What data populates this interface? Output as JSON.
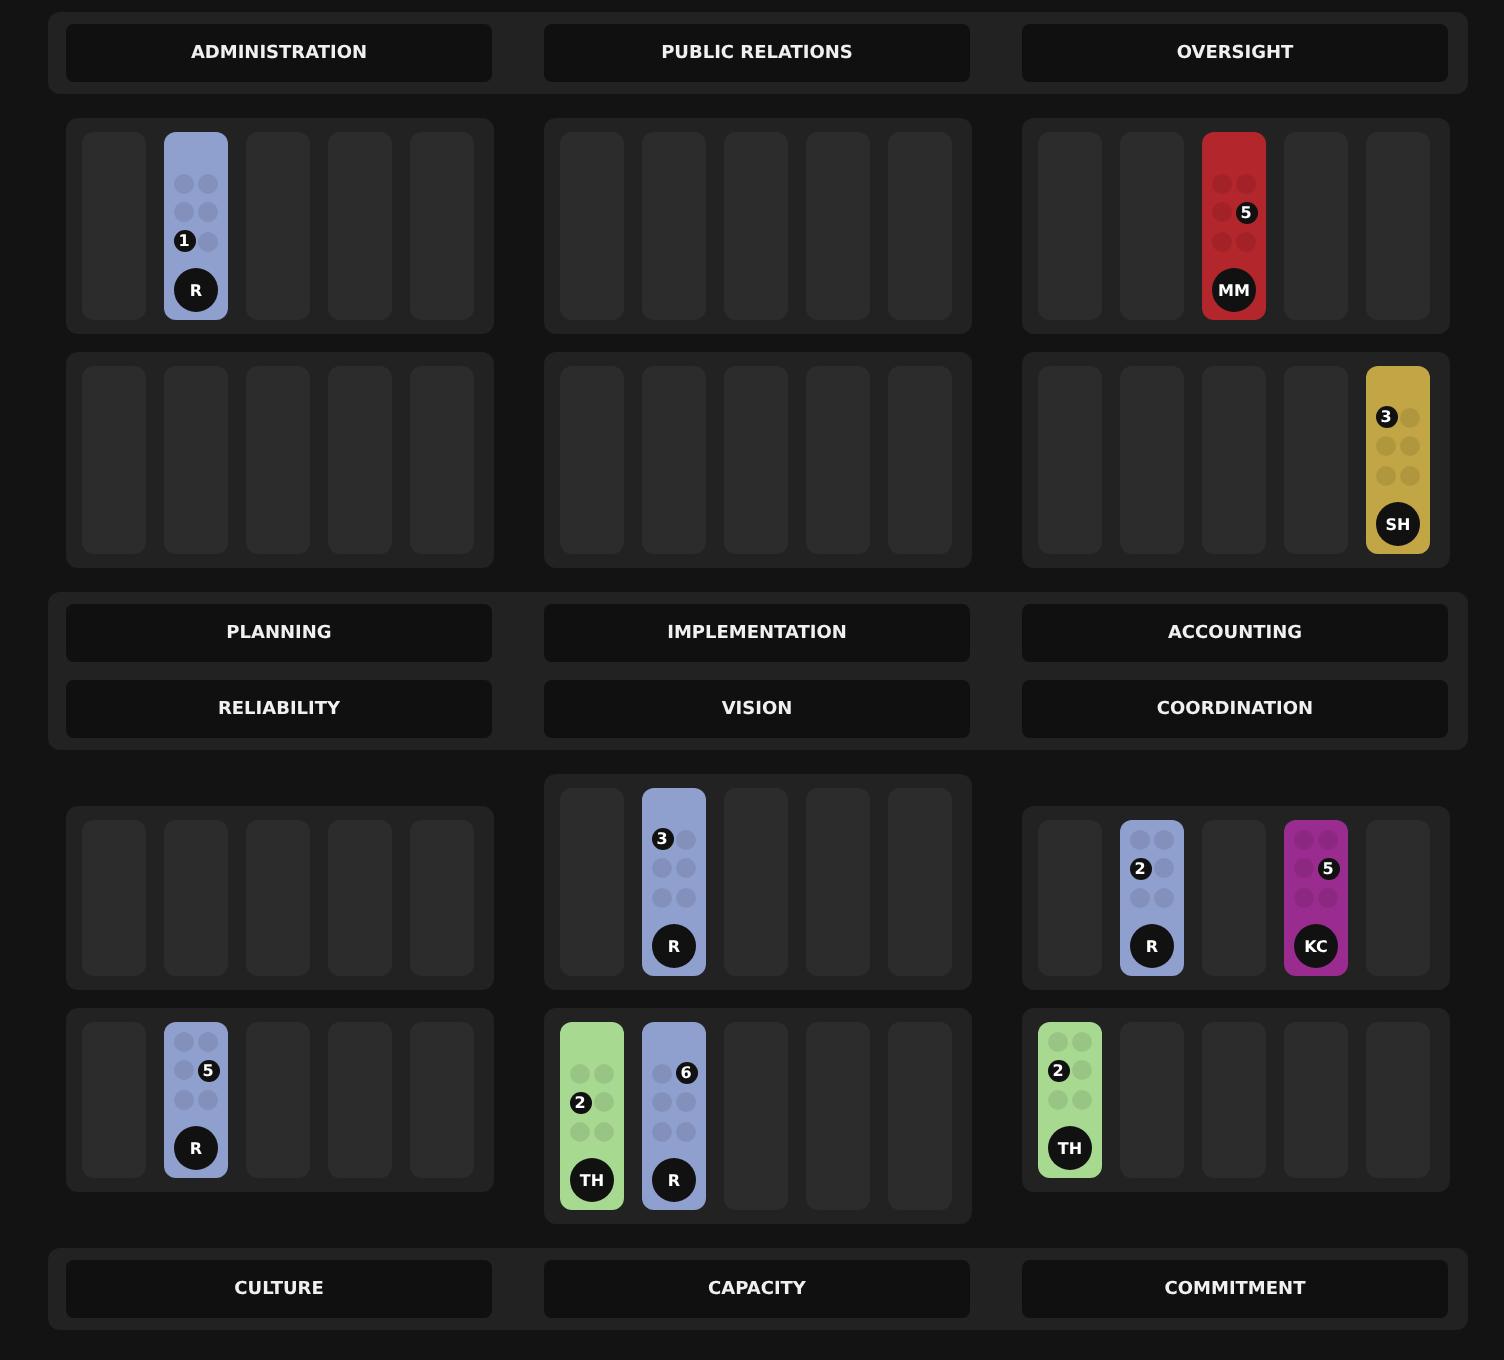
{
  "header": [
    "ADMINISTRATION",
    "PUBLIC RELATIONS",
    "OVERSIGHT"
  ],
  "upper": [
    {
      "panels": [
        {
          "slots": [
            {
              "kind": "empty"
            },
            {
              "kind": "token",
              "color": "#8f9fce",
              "count": "1",
              "initials": "R"
            },
            {
              "kind": "empty"
            },
            {
              "kind": "empty"
            },
            {
              "kind": "empty"
            }
          ]
        },
        {
          "slots": [
            {
              "kind": "empty"
            },
            {
              "kind": "empty"
            },
            {
              "kind": "empty"
            },
            {
              "kind": "empty"
            },
            {
              "kind": "empty"
            }
          ]
        }
      ]
    },
    {
      "panels": [
        {
          "slots": [
            {
              "kind": "empty"
            },
            {
              "kind": "empty"
            },
            {
              "kind": "empty"
            },
            {
              "kind": "empty"
            },
            {
              "kind": "empty"
            }
          ]
        },
        {
          "slots": [
            {
              "kind": "empty"
            },
            {
              "kind": "empty"
            },
            {
              "kind": "empty"
            },
            {
              "kind": "empty"
            },
            {
              "kind": "empty"
            }
          ]
        }
      ]
    },
    {
      "panels": [
        {
          "slots": [
            {
              "kind": "empty"
            },
            {
              "kind": "empty"
            },
            {
              "kind": "token",
              "color": "#b3262c",
              "count": "5",
              "initials": "MM"
            },
            {
              "kind": "empty"
            },
            {
              "kind": "empty"
            }
          ]
        },
        {
          "slots": [
            {
              "kind": "empty"
            },
            {
              "kind": "empty"
            },
            {
              "kind": "empty"
            },
            {
              "kind": "empty"
            },
            {
              "kind": "token",
              "color": "#c2a544",
              "count": "3",
              "initials": "SH"
            }
          ]
        }
      ]
    }
  ],
  "middle": [
    [
      "PLANNING",
      "IMPLEMENTATION",
      "ACCOUNTING"
    ],
    [
      "RELIABILITY",
      "VISION",
      "COORDINATION"
    ]
  ],
  "lower": [
    {
      "panels": [
        {
          "slots": [
            {
              "kind": "empty"
            },
            {
              "kind": "empty"
            },
            {
              "kind": "empty"
            },
            {
              "kind": "empty"
            },
            {
              "kind": "empty"
            }
          ]
        },
        {
          "slots": [
            {
              "kind": "empty"
            },
            {
              "kind": "token",
              "color": "#8f9fce",
              "count": "5",
              "initials": "R"
            },
            {
              "kind": "empty"
            },
            {
              "kind": "empty"
            },
            {
              "kind": "empty"
            }
          ]
        }
      ]
    },
    {
      "panels": [
        {
          "slots": [
            {
              "kind": "empty"
            },
            {
              "kind": "token",
              "color": "#8f9fce",
              "count": "3",
              "initials": "R"
            },
            {
              "kind": "empty"
            },
            {
              "kind": "empty"
            },
            {
              "kind": "empty"
            }
          ]
        },
        {
          "slots": [
            {
              "kind": "token",
              "color": "#a8d991",
              "count": "2",
              "initials": "TH"
            },
            {
              "kind": "token",
              "color": "#8f9fce",
              "count": "6",
              "initials": "R"
            },
            {
              "kind": "empty"
            },
            {
              "kind": "empty"
            },
            {
              "kind": "empty"
            }
          ]
        }
      ]
    },
    {
      "panels": [
        {
          "slots": [
            {
              "kind": "empty"
            },
            {
              "kind": "token",
              "color": "#8f9fce",
              "count": "2",
              "initials": "R"
            },
            {
              "kind": "empty"
            },
            {
              "kind": "token",
              "color": "#9b2c8f",
              "count": "5",
              "initials": "KC"
            },
            {
              "kind": "empty"
            }
          ]
        },
        {
          "slots": [
            {
              "kind": "token",
              "color": "#a8d991",
              "count": "2",
              "initials": "TH"
            },
            {
              "kind": "empty"
            },
            {
              "kind": "empty"
            },
            {
              "kind": "empty"
            },
            {
              "kind": "empty"
            }
          ]
        }
      ]
    }
  ],
  "footer": [
    "CULTURE",
    "CAPACITY",
    "COMMITMENT"
  ]
}
